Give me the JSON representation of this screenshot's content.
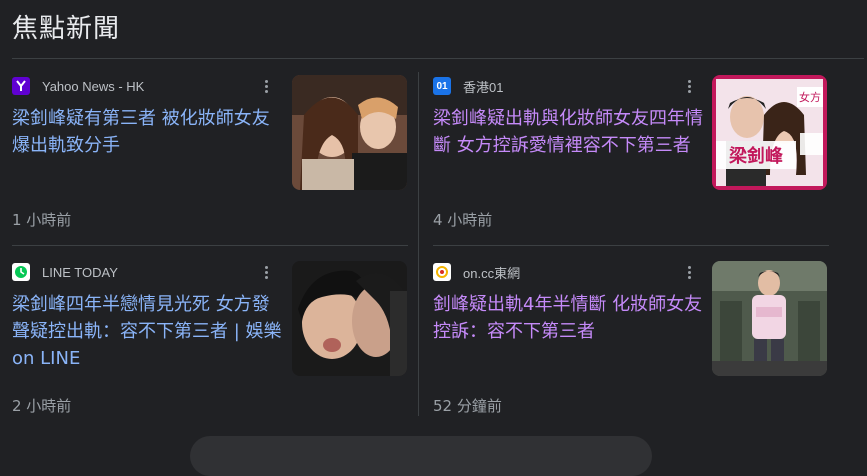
{
  "section": {
    "title": "焦點新聞"
  },
  "cards": [
    {
      "source": "Yahoo News - HK",
      "icon": "yahoo-logo-icon",
      "icon_color": "#6001d2",
      "headline": "梁釗峰疑有第三者 被化妝師女友爆出軌致分手",
      "time": "1 小時前",
      "visited": false
    },
    {
      "source": "香港01",
      "icon": "hk01-logo-icon",
      "icon_color": "#1a73e8",
      "headline": "梁釗峰疑出軌與化妝師女友四年情斷 女方控訴愛情裡容不下第三者",
      "time": "4 小時前",
      "visited": true,
      "thumb_text": [
        "梁釗峰",
        "女方"
      ]
    },
    {
      "source": "LINE TODAY",
      "icon": "line-logo-icon",
      "icon_color": "#06c755",
      "headline": "梁釗峰四年半戀情見光死 女方發聲疑控出軌：容不下第三者 | 娛樂 on LINE",
      "time": "2 小時前",
      "visited": false
    },
    {
      "source": "on.cc東網",
      "icon": "oncc-logo-icon",
      "icon_color": "#f4b400",
      "headline": "釗峰疑出軌4年半情斷 化妝師女友控訴：容不下第三者",
      "time": "52 分鐘前",
      "visited": true
    }
  ],
  "colors": {
    "link": "#8ab4f8",
    "visited": "#c58af9",
    "background": "#202124",
    "muted": "#9aa0a6"
  }
}
